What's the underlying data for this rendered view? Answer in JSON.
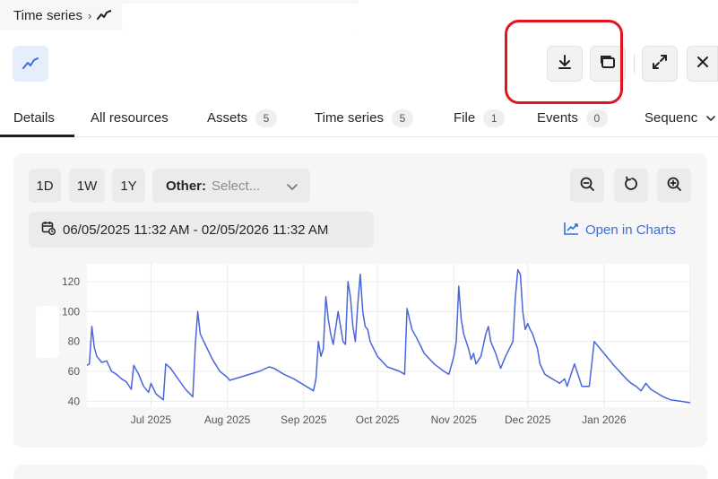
{
  "breadcrumb": {
    "root": "Time series",
    "separator": "›"
  },
  "toolbar": {
    "download_icon": "download-icon",
    "embed_icon": "embed-frame-icon",
    "expand_icon": "expand-icon",
    "close_icon": "close-icon"
  },
  "tabs": [
    {
      "label": "Details",
      "count": ""
    },
    {
      "label": "All resources",
      "count": ""
    },
    {
      "label": "Assets",
      "count": "5"
    },
    {
      "label": "Time series",
      "count": "5"
    },
    {
      "label": "File",
      "count": "1"
    },
    {
      "label": "Events",
      "count": "0"
    },
    {
      "label": "Sequenc",
      "count": ""
    }
  ],
  "controls": {
    "ranges": [
      "1D",
      "1W",
      "1Y"
    ],
    "other_label": "Other:",
    "other_placeholder": "Select...",
    "date_range": "06/05/2025 11:32 AM - 02/05/2026 11:32 AM",
    "open_in_charts": "Open in Charts"
  },
  "colors": {
    "accent": "#3b6fd6",
    "line": "#4a66d9",
    "highlight": "#e0161f"
  },
  "chart_data": {
    "type": "line",
    "title": "",
    "xlabel": "",
    "ylabel": "",
    "ylim": [
      36,
      132
    ],
    "yticks": [
      40,
      60,
      80,
      100,
      120
    ],
    "xticks": [
      "Jul 2025",
      "Aug 2025",
      "Sep 2025",
      "Oct 2025",
      "Nov 2025",
      "Dec 2025",
      "Jan 2026"
    ],
    "x_range": [
      "2025-06-05",
      "2026-02-05"
    ],
    "grid": true,
    "series": [
      {
        "name": "",
        "points": [
          [
            "2025-06-05",
            64
          ],
          [
            "2025-06-06",
            65
          ],
          [
            "2025-06-07",
            90
          ],
          [
            "2025-06-08",
            76
          ],
          [
            "2025-06-09",
            70
          ],
          [
            "2025-06-11",
            66
          ],
          [
            "2025-06-13",
            67
          ],
          [
            "2025-06-15",
            60
          ],
          [
            "2025-06-17",
            58
          ],
          [
            "2025-06-19",
            55
          ],
          [
            "2025-06-21",
            53
          ],
          [
            "2025-06-23",
            48
          ],
          [
            "2025-06-24",
            64
          ],
          [
            "2025-06-26",
            58
          ],
          [
            "2025-06-28",
            50
          ],
          [
            "2025-06-30",
            46
          ],
          [
            "2025-07-01",
            52
          ],
          [
            "2025-07-03",
            45
          ],
          [
            "2025-07-06",
            41
          ],
          [
            "2025-07-07",
            65
          ],
          [
            "2025-07-09",
            62
          ],
          [
            "2025-07-12",
            55
          ],
          [
            "2025-07-15",
            48
          ],
          [
            "2025-07-18",
            43
          ],
          [
            "2025-07-19",
            78
          ],
          [
            "2025-07-20",
            100
          ],
          [
            "2025-07-21",
            85
          ],
          [
            "2025-07-23",
            78
          ],
          [
            "2025-07-26",
            68
          ],
          [
            "2025-07-29",
            60
          ],
          [
            "2025-08-01",
            56
          ],
          [
            "2025-08-02",
            54
          ],
          [
            "2025-08-08",
            57
          ],
          [
            "2025-08-14",
            60
          ],
          [
            "2025-08-18",
            63
          ],
          [
            "2025-08-20",
            62
          ],
          [
            "2025-08-24",
            58
          ],
          [
            "2025-08-28",
            55
          ],
          [
            "2025-08-31",
            52
          ],
          [
            "2025-09-02",
            50
          ],
          [
            "2025-09-05",
            47
          ],
          [
            "2025-09-06",
            55
          ],
          [
            "2025-09-07",
            80
          ],
          [
            "2025-09-08",
            70
          ],
          [
            "2025-09-09",
            75
          ],
          [
            "2025-09-10",
            110
          ],
          [
            "2025-09-11",
            95
          ],
          [
            "2025-09-12",
            85
          ],
          [
            "2025-09-13",
            78
          ],
          [
            "2025-09-15",
            100
          ],
          [
            "2025-09-16",
            90
          ],
          [
            "2025-09-17",
            80
          ],
          [
            "2025-09-18",
            78
          ],
          [
            "2025-09-19",
            120
          ],
          [
            "2025-09-20",
            110
          ],
          [
            "2025-09-21",
            90
          ],
          [
            "2025-09-22",
            80
          ],
          [
            "2025-09-23",
            105
          ],
          [
            "2025-09-24",
            125
          ],
          [
            "2025-09-25",
            100
          ],
          [
            "2025-09-26",
            90
          ],
          [
            "2025-09-27",
            88
          ],
          [
            "2025-09-28",
            80
          ],
          [
            "2025-10-01",
            70
          ],
          [
            "2025-10-05",
            63
          ],
          [
            "2025-10-10",
            60
          ],
          [
            "2025-10-12",
            58
          ],
          [
            "2025-10-13",
            102
          ],
          [
            "2025-10-15",
            88
          ],
          [
            "2025-10-17",
            82
          ],
          [
            "2025-10-20",
            72
          ],
          [
            "2025-10-24",
            65
          ],
          [
            "2025-10-28",
            60
          ],
          [
            "2025-10-30",
            58
          ],
          [
            "2025-11-01",
            70
          ],
          [
            "2025-11-02",
            80
          ],
          [
            "2025-11-03",
            117
          ],
          [
            "2025-11-04",
            95
          ],
          [
            "2025-11-05",
            85
          ],
          [
            "2025-11-07",
            75
          ],
          [
            "2025-11-08",
            68
          ],
          [
            "2025-11-09",
            72
          ],
          [
            "2025-11-10",
            65
          ],
          [
            "2025-11-12",
            70
          ],
          [
            "2025-11-14",
            85
          ],
          [
            "2025-11-15",
            90
          ],
          [
            "2025-11-16",
            80
          ],
          [
            "2025-11-18",
            72
          ],
          [
            "2025-11-20",
            62
          ],
          [
            "2025-11-22",
            70
          ],
          [
            "2025-11-25",
            80
          ],
          [
            "2025-11-26",
            110
          ],
          [
            "2025-11-27",
            128
          ],
          [
            "2025-11-28",
            125
          ],
          [
            "2025-11-29",
            100
          ],
          [
            "2025-11-30",
            88
          ],
          [
            "2025-12-01",
            92
          ],
          [
            "2025-12-02",
            88
          ],
          [
            "2025-12-03",
            85
          ],
          [
            "2025-12-05",
            75
          ],
          [
            "2025-12-06",
            65
          ],
          [
            "2025-12-08",
            58
          ],
          [
            "2025-12-10",
            56
          ],
          [
            "2025-12-12",
            54
          ],
          [
            "2025-12-14",
            52
          ],
          [
            "2025-12-16",
            55
          ],
          [
            "2025-12-17",
            50
          ],
          [
            "2025-12-19",
            60
          ],
          [
            "2025-12-20",
            65
          ],
          [
            "2025-12-22",
            55
          ],
          [
            "2025-12-23",
            50
          ],
          [
            "2025-12-26",
            50
          ],
          [
            "2025-12-28",
            80
          ],
          [
            "2026-01-01",
            72
          ],
          [
            "2026-01-05",
            64
          ],
          [
            "2026-01-10",
            55
          ],
          [
            "2026-01-12",
            52
          ],
          [
            "2026-01-14",
            50
          ],
          [
            "2026-01-16",
            47
          ],
          [
            "2026-01-18",
            52
          ],
          [
            "2026-01-20",
            48
          ],
          [
            "2026-01-23",
            45
          ],
          [
            "2026-01-25",
            43
          ],
          [
            "2026-01-28",
            41
          ],
          [
            "2026-02-01",
            40
          ],
          [
            "2026-02-05",
            39
          ]
        ]
      }
    ]
  }
}
